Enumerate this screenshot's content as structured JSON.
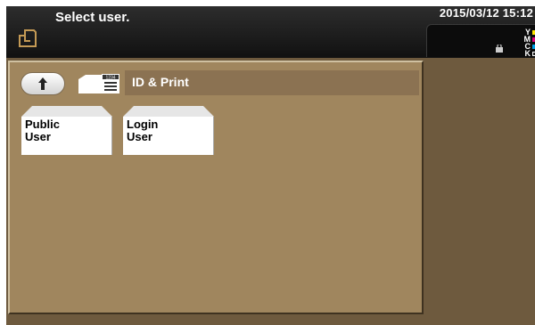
{
  "header": {
    "title": "Select user.",
    "datetime": "2015/03/12 15:12",
    "home_icon": "home-copy-icon",
    "lock_icon": "lock-icon"
  },
  "toner": [
    {
      "letter": "Y",
      "color": "#ffe400",
      "level": 1.0
    },
    {
      "letter": "M",
      "color": "#e0007a",
      "level": 1.0
    },
    {
      "letter": "C",
      "color": "#00a0e6",
      "level": 1.0
    },
    {
      "letter": "K",
      "color": "#222222",
      "level": 1.0
    }
  ],
  "navigation": {
    "up_icon": "up-arrow-icon",
    "folder_icon": "box-icon",
    "box_number": "1234",
    "breadcrumb": "ID & Print"
  },
  "users": [
    {
      "line1": "Public",
      "line2": "User"
    },
    {
      "line1": "Login",
      "line2": "User"
    }
  ]
}
